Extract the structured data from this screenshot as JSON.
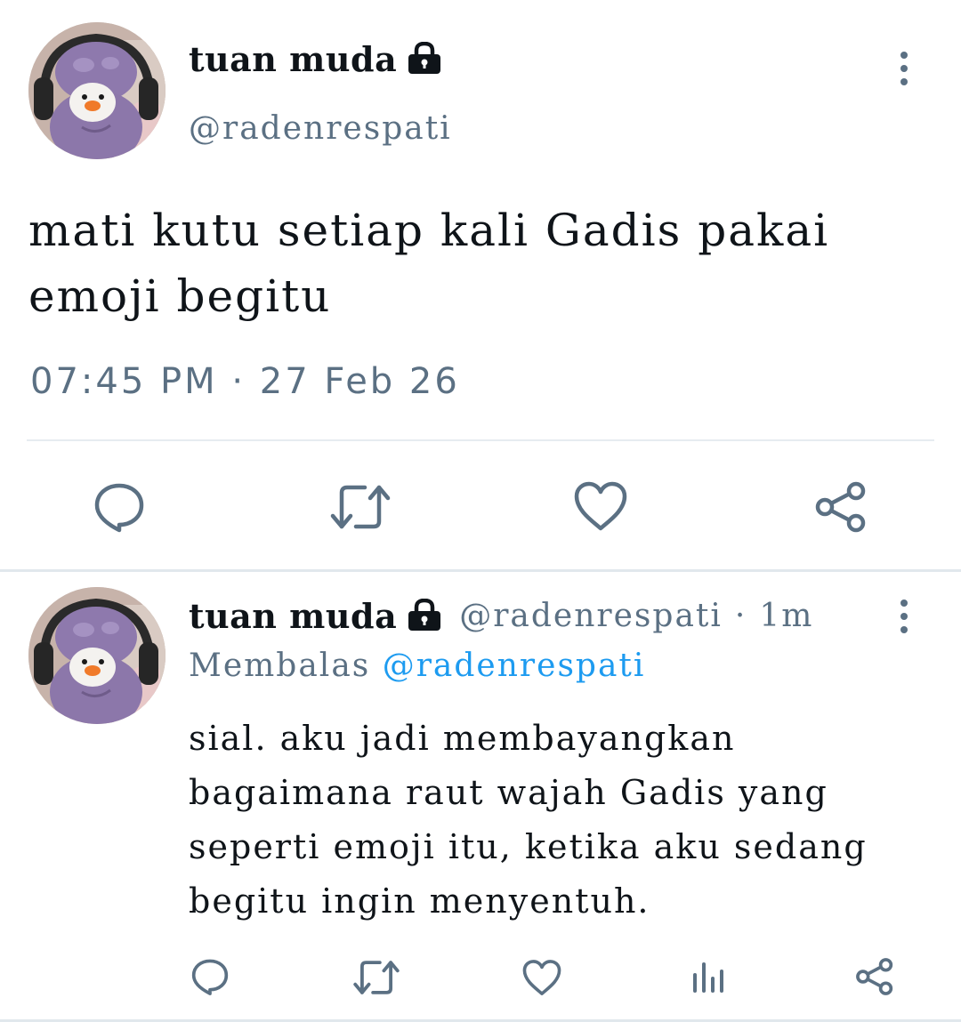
{
  "main_tweet": {
    "author_name": "tuan muda",
    "author_handle": "@radenrespati",
    "text": "mati kutu setiap kali Gadis pakai emoji begitu",
    "timestamp": "07:45 PM · 27 Feb 26",
    "avatar_icon": "avatar-purple-bonnet",
    "actions": [
      "reply-icon",
      "retweet-icon",
      "like-icon",
      "share-icon"
    ]
  },
  "reply_tweet": {
    "author_name": "tuan muda",
    "author_handle": "@radenrespati",
    "separator": "·",
    "time_ago": "1m",
    "replying_label": "Membalas",
    "replying_to": "@radenrespati",
    "text": "sial. aku jadi membayangkan bagaimana raut wajah Gadis yang seperti emoji itu, ketika aku sedang begitu ingin menyentuh.",
    "actions": [
      "reply-icon",
      "retweet-icon",
      "like-icon",
      "analytics-icon",
      "share-icon"
    ]
  },
  "colors": {
    "text": "#0f1419",
    "secondary": "#5b7083",
    "link": "#1d9bf0",
    "divider": "#e6ecf0"
  }
}
